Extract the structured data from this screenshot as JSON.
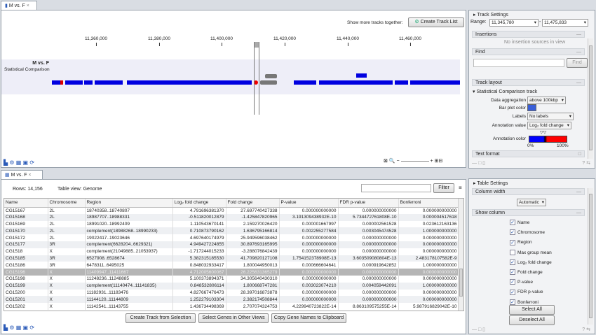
{
  "top": {
    "tab": "M vs. F",
    "show_more": "Show more tracks together:",
    "create_track_list": "Create Track List",
    "ruler": [
      "11,360,000",
      "11,380,000",
      "11,400,000",
      "11,420,000",
      "11,440,000",
      "11,460,000"
    ],
    "track_name": "M vs. F",
    "track_type": "Statistical Comparison"
  },
  "track_settings": {
    "title": "Track Settings",
    "range_label": "Range:",
    "range_from": "11,345,780",
    "range_sep": "-",
    "range_to": "11,475,833",
    "insertions": "Insertions",
    "no_insertions": "No insertion sources in view",
    "find": "Find",
    "find_button": "Find",
    "track_layout": "Track layout",
    "stat_track": "Statistical Comparison track",
    "data_aggregation_label": "Data aggregation",
    "data_aggregation": "above 100kbp",
    "bar_plot_color_label": "Bar plot color",
    "bar_plot_color": "#3a5fd8",
    "labels_label": "Labels",
    "labels": "No labels",
    "annotation_value_label": "Annotation value",
    "annotation_value": "Log₂ fold change",
    "annotation_color_label": "Annotation color",
    "pct_min": "0%",
    "pct_max": "100%",
    "text_format": "Text format"
  },
  "bottom": {
    "tab": "M vs. F",
    "rows": "Rows: 14,156",
    "table_view": "Table view: Genome",
    "filter": "Filter",
    "columns": [
      "Name",
      "Chromosome",
      "Region",
      "Log₂ fold change",
      "Fold change",
      "P-value",
      "FDR p-value",
      "Bonferroni"
    ],
    "rows_data": [
      [
        "CG15167",
        "2L",
        "18740358..18740807",
        "4.791696381370",
        "27.697740427338",
        "0.000000000000",
        "0.000000000000",
        "0.000000000000"
      ],
      [
        "CG15168",
        "2L",
        "18987707..18988331",
        "-0.511820012879",
        "-1.425847820965",
        "3.191309438932E-10",
        "5.734472761808E-10",
        "0.000004517618"
      ],
      [
        "CG15169",
        "2L",
        "18991020..18992409",
        "1.110543670141",
        "2.159270026420",
        "0.000001667997",
        "0.000002561528",
        "0.023612163136"
      ],
      [
        "CG15170",
        "2L",
        "complement(18988268..18990233)",
        "0.710873790162",
        "1.636795166814",
        "0.002255277584",
        "0.003045474528",
        "1.000000000000"
      ],
      [
        "CG15172",
        "2L",
        "19022417..19023646",
        "4.697640174979",
        "25.949596038462",
        "0.000000000000",
        "0.000000000000",
        "0.000000000000"
      ],
      [
        "CG15177",
        "3R",
        "complement(6628204..6629321)",
        "4.949427224855",
        "30.897693165995",
        "0.000000000000",
        "0.000000000000",
        "0.000000000000"
      ],
      [
        "CG1518",
        "X",
        "complement(21049885..21053937)",
        "-1.717244015233",
        "-3.288076842439",
        "0.000000000000",
        "0.000000000000",
        "0.000000000000"
      ],
      [
        "CG15185",
        "3R",
        "6527908..6528674",
        "5.382315185530",
        "41.709820127108",
        "1.754152378908E-13",
        "3.603509080804E-13",
        "2.483178107582E-9"
      ],
      [
        "CG15186",
        "3R",
        "6478311..6495025",
        "0.848032933417",
        "1.800044950013",
        "0.000666604641",
        "0.000919642852",
        "1.000000000000"
      ],
      [
        "CG15196",
        "X",
        "11409947..11411667",
        "4.712005600067",
        "26.225631365279",
        "0.000000000000",
        "0.000000000000",
        "0.000000000000"
      ],
      [
        "CG15198",
        "X",
        "11248236..11248885",
        "5.100373894371",
        "34.305640430310",
        "0.000000000000",
        "0.000000000000",
        "0.000000000000"
      ],
      [
        "CG15199",
        "X",
        "complement(11140474..11141835)",
        "0.848532806114",
        "1.800668747281",
        "0.003023074210",
        "0.004059442091",
        "1.000000000000"
      ],
      [
        "CG15200",
        "X",
        "11182931..11183476",
        "4.827667476473",
        "28.397016873878",
        "0.000000000000",
        "0.000000000000",
        "0.000000000000"
      ],
      [
        "CG15201",
        "X",
        "11144120..11144809",
        "1.252279103304",
        "2.382174508844",
        "0.000000000000",
        "0.000000000000",
        "0.000000000000"
      ],
      [
        "CG15202",
        "X",
        "11142541..11143755",
        "1.436734498369",
        "2.707074324753",
        "4.229940723822E-14",
        "8.863109575255E-14",
        "5.987916829042E-10"
      ]
    ],
    "selected_row": 9,
    "create_track": "Create Track from Selection",
    "select_genes": "Select Genes in Other Views",
    "copy_names": "Copy Gene Names to Clipboard"
  },
  "table_settings": {
    "title": "Table Settings",
    "column_width": "Column width",
    "column_width_value": "Automatic",
    "show_column": "Show column",
    "columns": [
      {
        "label": "Name",
        "checked": true
      },
      {
        "label": "Chromosome",
        "checked": true
      },
      {
        "label": "Region",
        "checked": true
      },
      {
        "label": "Max group mean",
        "checked": false
      },
      {
        "label": "Log₂ fold change",
        "checked": true
      },
      {
        "label": "Fold change",
        "checked": true
      },
      {
        "label": "P-value",
        "checked": true
      },
      {
        "label": "FDR p-value",
        "checked": true
      },
      {
        "label": "Bonferroni",
        "checked": true
      }
    ],
    "select_all": "Select All",
    "deselect_all": "Deselect All"
  }
}
